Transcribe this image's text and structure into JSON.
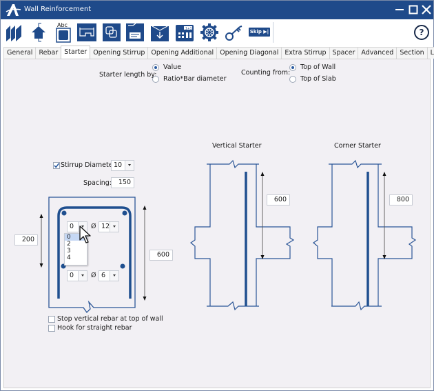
{
  "window": {
    "title": "Wall Reinforcement",
    "controls": {
      "minimize": "—",
      "maximize": "☐",
      "close": "✕"
    }
  },
  "toolbar": {
    "buttons": [
      {
        "icon": "wall-panels-icon",
        "label": "Walls"
      },
      {
        "icon": "house-icon",
        "label": "Home"
      },
      {
        "icon": "label-abc-icon",
        "label": "Label"
      },
      {
        "icon": "stirrup-shape-icon",
        "label": "Shape"
      },
      {
        "icon": "copy-overlap-icon",
        "label": "Copy"
      },
      {
        "icon": "save-disk-icon",
        "label": "Save"
      },
      {
        "icon": "download-tray-icon",
        "label": "Load"
      },
      {
        "icon": "calculator-icon",
        "label": "Calculate"
      },
      {
        "icon": "settings-wheel-icon",
        "label": "Settings"
      },
      {
        "icon": "key-icon",
        "label": "License"
      }
    ],
    "skip_label": "Skip ▶|",
    "help_label": "?"
  },
  "tabs": [
    {
      "label": "General",
      "active": false
    },
    {
      "label": "Rebar",
      "active": false
    },
    {
      "label": "Starter",
      "active": true
    },
    {
      "label": "Opening Stirrup",
      "active": false
    },
    {
      "label": "Opening Additional",
      "active": false
    },
    {
      "label": "Opening Diagonal",
      "active": false
    },
    {
      "label": "Extra Stirrup",
      "active": false
    },
    {
      "label": "Spacer",
      "active": false
    },
    {
      "label": "Advanced",
      "active": false
    },
    {
      "label": "Section",
      "active": false
    },
    {
      "label": "Label",
      "active": false
    }
  ],
  "starter": {
    "length_by_label": "Starter length by:",
    "length_by_options": [
      {
        "label": "Value",
        "selected": true
      },
      {
        "label": "Ratio*Bar diameter",
        "selected": false
      }
    ],
    "counting_from_label": "Counting from:",
    "counting_from_options": [
      {
        "label": "Top of Wall",
        "selected": true
      },
      {
        "label": "Top of Slab",
        "selected": false
      }
    ],
    "stirrup_diameter_label": "Stirrup Diameter:",
    "stirrup_diameter_checked": true,
    "stirrup_diameter_value": "10",
    "spacing_label": "Spacing:",
    "spacing_value": "150",
    "section": {
      "width_dim": "200",
      "height_dim": "600",
      "top_count": "0",
      "top_diameter_symbol": "Ø",
      "top_diameter": "12",
      "top_count_options": [
        "0",
        "2",
        "3",
        "4"
      ],
      "top_count_highlighted": "0",
      "bottom_count": "0",
      "bottom_diameter_symbol": "Ø",
      "bottom_diameter": "6"
    },
    "stop_vertical_label": "Stop vertical rebar at top of wall",
    "stop_vertical_checked": false,
    "hook_label": "Hook for straight rebar",
    "hook_checked": false,
    "vertical_starter": {
      "title": "Vertical Starter",
      "length": "600"
    },
    "corner_starter": {
      "title": "Corner Starter",
      "length": "800"
    }
  },
  "colors": {
    "titlebar": "#1f4a8a",
    "drawing_line": "#2a5596",
    "rebar": "#1f4f8f",
    "panel_bg": "#f2f0f4"
  }
}
